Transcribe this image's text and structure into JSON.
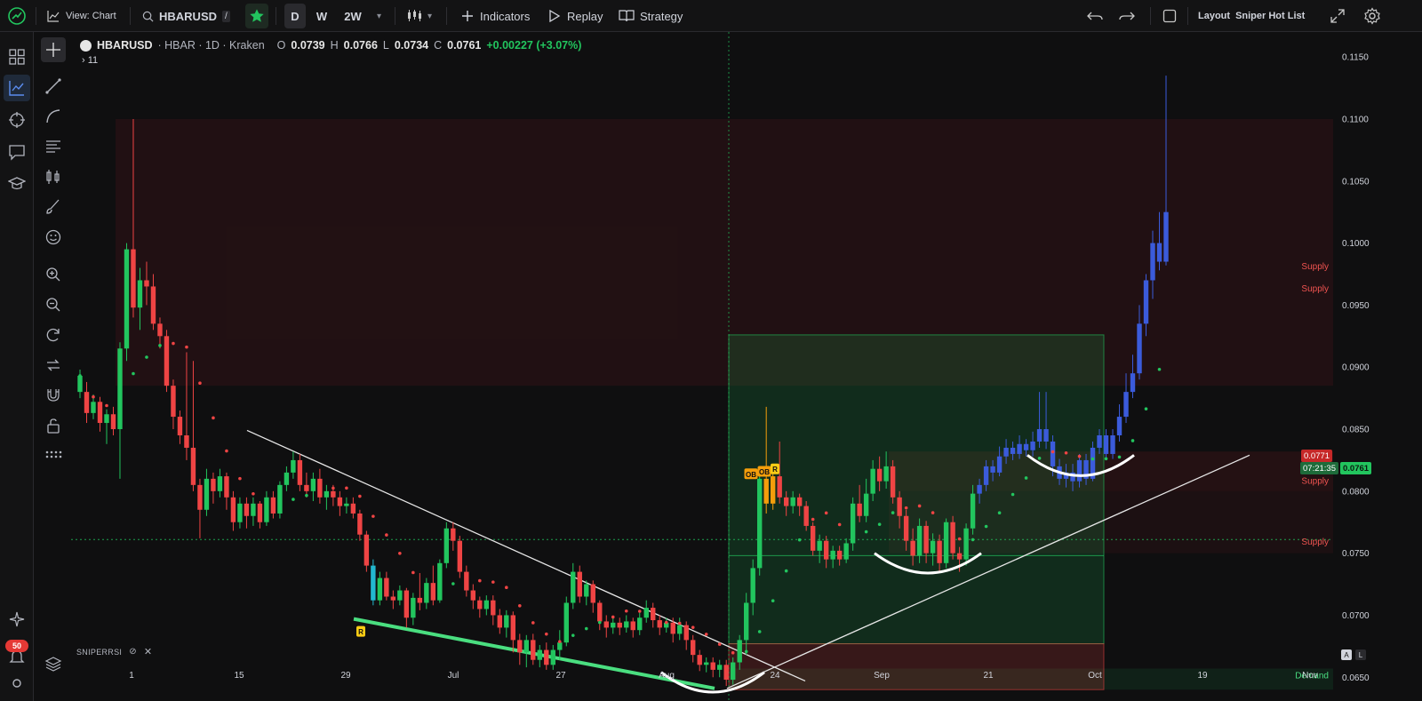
{
  "toolbar": {
    "view_label": "View: Chart",
    "symbol": "HBARUSD",
    "intervals": [
      "D",
      "W",
      "2W"
    ],
    "active_interval": "D",
    "indicators_label": "Indicators",
    "replay_label": "Replay",
    "strategy_label": "Strategy",
    "layout_prefix": "Layout",
    "layout_name": "Sniper Hot List"
  },
  "legend": {
    "symbol": "HBARUSD",
    "details": "· HBAR · 1D · Kraken",
    "open_label": "O",
    "open": "0.0739",
    "high_label": "H",
    "high": "0.0766",
    "low_label": "L",
    "low": "0.0734",
    "close_label": "C",
    "close": "0.0761",
    "change": "+0.00227 (+3.07%)",
    "collapsed": "11"
  },
  "indicator_pane": {
    "name": "SNIPERRSI"
  },
  "notifications": {
    "count": "50"
  },
  "price_tags": {
    "upper_value": "0.0771",
    "countdown": "07:21:35",
    "current": "0.0761"
  },
  "axis_buttons": {
    "auto": "A",
    "log": "L"
  },
  "colors": {
    "bull": "#22c55e",
    "bear": "#ef4444",
    "supply": "#ef4444",
    "demand": "#22c55e",
    "accent": "#2962ff",
    "blue_candle": "#3b5bdb"
  },
  "chart_data": {
    "type": "candlestick",
    "symbol": "HBARUSD",
    "timeframe": "1D",
    "x_tick_labels": [
      "1",
      "15",
      "29",
      "Jul",
      "27",
      "Aug",
      "24",
      "Sep",
      "21",
      "Oct",
      "19",
      "Nov"
    ],
    "y_tick_labels": [
      "0.1150",
      "0.1100",
      "0.1050",
      "0.1000",
      "0.0950",
      "0.0900",
      "0.0850",
      "0.0800",
      "0.0750",
      "0.0700",
      "0.0650"
    ],
    "ylim": [
      0.0633,
      0.1163
    ],
    "zones": [
      {
        "label": "Supply",
        "from": 0.0885,
        "to": 0.11
      },
      {
        "label": "Supply",
        "from": 0.0885,
        "to": 0.11
      },
      {
        "label": "Supply",
        "from": 0.08,
        "to": 0.0832
      },
      {
        "label": "Supply",
        "from": 0.075,
        "to": 0.08
      },
      {
        "label": "Demand",
        "from": 0.064,
        "to": 0.0657
      }
    ],
    "markers": [
      {
        "text": "R",
        "price": 0.069
      },
      {
        "text": "OB",
        "price": 0.0814
      },
      {
        "text": "OB",
        "price": 0.0816
      },
      {
        "text": "R",
        "price": 0.0818
      }
    ],
    "candles_segments": [
      {
        "o": 0.088,
        "c": 0.0893,
        "h": 0.0898,
        "l": 0.0875
      },
      {
        "o": 0.088,
        "c": 0.0863,
        "h": 0.0888,
        "l": 0.0855
      },
      {
        "o": 0.0863,
        "c": 0.0872,
        "h": 0.0878,
        "l": 0.0858
      },
      {
        "o": 0.0872,
        "c": 0.0855,
        "h": 0.0876,
        "l": 0.0848
      },
      {
        "o": 0.0855,
        "c": 0.0862,
        "h": 0.0866,
        "l": 0.0838
      },
      {
        "o": 0.0862,
        "c": 0.085,
        "h": 0.0868,
        "l": 0.0845
      },
      {
        "o": 0.085,
        "c": 0.0915,
        "h": 0.092,
        "l": 0.081
      },
      {
        "o": 0.0915,
        "c": 0.0995,
        "h": 0.1,
        "l": 0.0905
      },
      {
        "o": 0.0995,
        "c": 0.0948,
        "h": 0.11,
        "l": 0.094
      },
      {
        "o": 0.0948,
        "c": 0.097,
        "h": 0.098,
        "l": 0.093
      },
      {
        "o": 0.097,
        "c": 0.0965,
        "h": 0.0985,
        "l": 0.095
      },
      {
        "o": 0.0965,
        "c": 0.0935,
        "h": 0.0975,
        "l": 0.093
      },
      {
        "o": 0.0935,
        "c": 0.0925,
        "h": 0.094,
        "l": 0.0915
      },
      {
        "o": 0.0925,
        "c": 0.0885,
        "h": 0.093,
        "l": 0.088
      },
      {
        "o": 0.0885,
        "c": 0.086,
        "h": 0.089,
        "l": 0.085
      },
      {
        "o": 0.086,
        "c": 0.0845,
        "h": 0.0865,
        "l": 0.0838
      },
      {
        "o": 0.0845,
        "c": 0.0835,
        "h": 0.0912,
        "l": 0.0825
      },
      {
        "o": 0.0835,
        "c": 0.0805,
        "h": 0.0905,
        "l": 0.08
      },
      {
        "o": 0.0805,
        "c": 0.0785,
        "h": 0.081,
        "l": 0.0762
      },
      {
        "o": 0.0785,
        "c": 0.081,
        "h": 0.0818,
        "l": 0.078
      },
      {
        "o": 0.081,
        "c": 0.08,
        "h": 0.0815,
        "l": 0.079
      },
      {
        "o": 0.08,
        "c": 0.0812,
        "h": 0.0818,
        "l": 0.0795
      },
      {
        "o": 0.0812,
        "c": 0.0795,
        "h": 0.0815,
        "l": 0.0785
      },
      {
        "o": 0.0795,
        "c": 0.0775,
        "h": 0.08,
        "l": 0.0768
      },
      {
        "o": 0.0775,
        "c": 0.079,
        "h": 0.0795,
        "l": 0.077
      },
      {
        "o": 0.079,
        "c": 0.078,
        "h": 0.0795,
        "l": 0.077
      },
      {
        "o": 0.078,
        "c": 0.079,
        "h": 0.0795,
        "l": 0.0772
      },
      {
        "o": 0.079,
        "c": 0.0775,
        "h": 0.0792,
        "l": 0.077
      },
      {
        "o": 0.0775,
        "c": 0.0795,
        "h": 0.08,
        "l": 0.0772
      },
      {
        "o": 0.0795,
        "c": 0.0782,
        "h": 0.08,
        "l": 0.0778
      },
      {
        "o": 0.0782,
        "c": 0.0805,
        "h": 0.0808,
        "l": 0.0778
      },
      {
        "o": 0.0805,
        "c": 0.0815,
        "h": 0.082,
        "l": 0.08
      },
      {
        "o": 0.0815,
        "c": 0.0825,
        "h": 0.0832,
        "l": 0.081
      },
      {
        "o": 0.0825,
        "c": 0.0805,
        "h": 0.083,
        "l": 0.08
      },
      {
        "o": 0.0805,
        "c": 0.08,
        "h": 0.0815,
        "l": 0.0795
      },
      {
        "o": 0.08,
        "c": 0.081,
        "h": 0.0815,
        "l": 0.0792
      },
      {
        "o": 0.081,
        "c": 0.0795,
        "h": 0.0818,
        "l": 0.079
      },
      {
        "o": 0.0795,
        "c": 0.08,
        "h": 0.0805,
        "l": 0.0785
      },
      {
        "o": 0.08,
        "c": 0.0795,
        "h": 0.0805,
        "l": 0.0788
      },
      {
        "o": 0.0795,
        "c": 0.0788,
        "h": 0.08,
        "l": 0.078
      },
      {
        "o": 0.0788,
        "c": 0.079,
        "h": 0.0795,
        "l": 0.0782
      },
      {
        "o": 0.079,
        "c": 0.0782,
        "h": 0.0795,
        "l": 0.0778
      },
      {
        "o": 0.0782,
        "c": 0.0765,
        "h": 0.0785,
        "l": 0.076
      },
      {
        "o": 0.0765,
        "c": 0.074,
        "h": 0.0768,
        "l": 0.0735
      },
      {
        "o": 0.074,
        "c": 0.0712,
        "h": 0.0745,
        "l": 0.0708
      },
      {
        "o": 0.0712,
        "c": 0.073,
        "h": 0.0735,
        "l": 0.0708
      },
      {
        "o": 0.073,
        "c": 0.0715,
        "h": 0.0735,
        "l": 0.0712
      },
      {
        "o": 0.0715,
        "c": 0.0712,
        "h": 0.072,
        "l": 0.0705
      },
      {
        "o": 0.0712,
        "c": 0.072,
        "h": 0.0724,
        "l": 0.0708
      },
      {
        "o": 0.072,
        "c": 0.0698,
        "h": 0.0722,
        "l": 0.069
      },
      {
        "o": 0.0698,
        "c": 0.0714,
        "h": 0.0718,
        "l": 0.0692
      },
      {
        "o": 0.0714,
        "c": 0.071,
        "h": 0.0734,
        "l": 0.0704
      },
      {
        "o": 0.071,
        "c": 0.0726,
        "h": 0.073,
        "l": 0.0705
      },
      {
        "o": 0.0726,
        "c": 0.0712,
        "h": 0.074,
        "l": 0.0708
      },
      {
        "o": 0.0712,
        "c": 0.0742,
        "h": 0.0745,
        "l": 0.071
      },
      {
        "o": 0.0742,
        "c": 0.077,
        "h": 0.0775,
        "l": 0.0738
      },
      {
        "o": 0.077,
        "c": 0.076,
        "h": 0.0775,
        "l": 0.0752
      },
      {
        "o": 0.076,
        "c": 0.0735,
        "h": 0.0764,
        "l": 0.073
      },
      {
        "o": 0.0735,
        "c": 0.072,
        "h": 0.074,
        "l": 0.0715
      },
      {
        "o": 0.072,
        "c": 0.0712,
        "h": 0.0725,
        "l": 0.0705
      },
      {
        "o": 0.0712,
        "c": 0.0705,
        "h": 0.0715,
        "l": 0.0698
      },
      {
        "o": 0.0705,
        "c": 0.0712,
        "h": 0.0716,
        "l": 0.07
      },
      {
        "o": 0.0712,
        "c": 0.07,
        "h": 0.0716,
        "l": 0.0692
      },
      {
        "o": 0.07,
        "c": 0.069,
        "h": 0.0705,
        "l": 0.0685
      },
      {
        "o": 0.069,
        "c": 0.07,
        "h": 0.0704,
        "l": 0.0682
      },
      {
        "o": 0.07,
        "c": 0.068,
        "h": 0.0703,
        "l": 0.067
      },
      {
        "o": 0.068,
        "c": 0.067,
        "h": 0.0685,
        "l": 0.066
      },
      {
        "o": 0.067,
        "c": 0.068,
        "h": 0.0684,
        "l": 0.0658
      },
      {
        "o": 0.068,
        "c": 0.0664,
        "h": 0.0685,
        "l": 0.066
      },
      {
        "o": 0.0664,
        "c": 0.0672,
        "h": 0.0676,
        "l": 0.0658
      },
      {
        "o": 0.0672,
        "c": 0.066,
        "h": 0.0678,
        "l": 0.0656
      },
      {
        "o": 0.066,
        "c": 0.0672,
        "h": 0.0676,
        "l": 0.0656
      },
      {
        "o": 0.0672,
        "c": 0.0678,
        "h": 0.0688,
        "l": 0.0664
      },
      {
        "o": 0.0678,
        "c": 0.071,
        "h": 0.0715,
        "l": 0.0675
      },
      {
        "o": 0.071,
        "c": 0.0735,
        "h": 0.0742,
        "l": 0.0705
      },
      {
        "o": 0.0735,
        "c": 0.0715,
        "h": 0.074,
        "l": 0.071
      },
      {
        "o": 0.0715,
        "c": 0.0725,
        "h": 0.0728,
        "l": 0.0708
      },
      {
        "o": 0.0725,
        "c": 0.071,
        "h": 0.0728,
        "l": 0.0702
      },
      {
        "o": 0.071,
        "c": 0.0695,
        "h": 0.0712,
        "l": 0.0688
      },
      {
        "o": 0.0695,
        "c": 0.069,
        "h": 0.07,
        "l": 0.0682
      },
      {
        "o": 0.069,
        "c": 0.0694,
        "h": 0.0698,
        "l": 0.0685
      },
      {
        "o": 0.0694,
        "c": 0.069,
        "h": 0.0698,
        "l": 0.0684
      },
      {
        "o": 0.069,
        "c": 0.0695,
        "h": 0.07,
        "l": 0.0686
      },
      {
        "o": 0.0695,
        "c": 0.0688,
        "h": 0.0698,
        "l": 0.0682
      },
      {
        "o": 0.0688,
        "c": 0.0698,
        "h": 0.0702,
        "l": 0.0684
      },
      {
        "o": 0.0698,
        "c": 0.0706,
        "h": 0.0712,
        "l": 0.0694
      },
      {
        "o": 0.0706,
        "c": 0.0696,
        "h": 0.071,
        "l": 0.069
      },
      {
        "o": 0.0696,
        "c": 0.069,
        "h": 0.07,
        "l": 0.0684
      },
      {
        "o": 0.069,
        "c": 0.0694,
        "h": 0.0698,
        "l": 0.0686
      },
      {
        "o": 0.0694,
        "c": 0.0685,
        "h": 0.0698,
        "l": 0.0678
      },
      {
        "o": 0.0685,
        "c": 0.0692,
        "h": 0.0698,
        "l": 0.068
      },
      {
        "o": 0.0692,
        "c": 0.068,
        "h": 0.0695,
        "l": 0.0672
      },
      {
        "o": 0.068,
        "c": 0.0668,
        "h": 0.0684,
        "l": 0.0662
      },
      {
        "o": 0.0668,
        "c": 0.066,
        "h": 0.0672,
        "l": 0.0655
      },
      {
        "o": 0.066,
        "c": 0.0662,
        "h": 0.0666,
        "l": 0.0654
      },
      {
        "o": 0.0662,
        "c": 0.0656,
        "h": 0.0666,
        "l": 0.065
      },
      {
        "o": 0.0656,
        "c": 0.066,
        "h": 0.0664,
        "l": 0.065
      },
      {
        "o": 0.066,
        "c": 0.0648,
        "h": 0.0664,
        "l": 0.0643
      },
      {
        "o": 0.0648,
        "c": 0.0662,
        "h": 0.0666,
        "l": 0.0644
      },
      {
        "o": 0.0662,
        "c": 0.068,
        "h": 0.0684,
        "l": 0.0656
      },
      {
        "o": 0.068,
        "c": 0.071,
        "h": 0.0718,
        "l": 0.0668
      },
      {
        "o": 0.071,
        "c": 0.0738,
        "h": 0.0745,
        "l": 0.07
      },
      {
        "o": 0.0738,
        "c": 0.081,
        "h": 0.0815,
        "l": 0.0732
      },
      {
        "o": 0.081,
        "c": 0.079,
        "h": 0.0868,
        "l": 0.0782
      },
      {
        "o": 0.079,
        "c": 0.0812,
        "h": 0.0818,
        "l": 0.0785
      },
      {
        "o": 0.0812,
        "c": 0.0795,
        "h": 0.084,
        "l": 0.079
      },
      {
        "o": 0.0795,
        "c": 0.0788,
        "h": 0.08,
        "l": 0.078
      },
      {
        "o": 0.0788,
        "c": 0.0795,
        "h": 0.08,
        "l": 0.0782
      },
      {
        "o": 0.0795,
        "c": 0.0788,
        "h": 0.0798,
        "l": 0.078
      },
      {
        "o": 0.0788,
        "c": 0.0772,
        "h": 0.0792,
        "l": 0.0768
      },
      {
        "o": 0.0772,
        "c": 0.0752,
        "h": 0.0775,
        "l": 0.0748
      },
      {
        "o": 0.0752,
        "c": 0.076,
        "h": 0.0765,
        "l": 0.0742
      },
      {
        "o": 0.076,
        "c": 0.0745,
        "h": 0.0764,
        "l": 0.0738
      },
      {
        "o": 0.0745,
        "c": 0.0752,
        "h": 0.0756,
        "l": 0.0738
      },
      {
        "o": 0.0752,
        "c": 0.0745,
        "h": 0.0756,
        "l": 0.074
      },
      {
        "o": 0.0745,
        "c": 0.0758,
        "h": 0.0762,
        "l": 0.0742
      },
      {
        "o": 0.0758,
        "c": 0.079,
        "h": 0.0795,
        "l": 0.0752
      },
      {
        "o": 0.079,
        "c": 0.078,
        "h": 0.0805,
        "l": 0.0775
      },
      {
        "o": 0.078,
        "c": 0.0798,
        "h": 0.081,
        "l": 0.0775
      },
      {
        "o": 0.0798,
        "c": 0.0818,
        "h": 0.0825,
        "l": 0.0792
      },
      {
        "o": 0.0818,
        "c": 0.0808,
        "h": 0.0828,
        "l": 0.08
      },
      {
        "o": 0.0808,
        "c": 0.082,
        "h": 0.0832,
        "l": 0.0802
      },
      {
        "o": 0.082,
        "c": 0.0795,
        "h": 0.0825,
        "l": 0.079
      },
      {
        "o": 0.0795,
        "c": 0.078,
        "h": 0.08,
        "l": 0.077
      },
      {
        "o": 0.078,
        "c": 0.076,
        "h": 0.0785,
        "l": 0.0752
      },
      {
        "o": 0.076,
        "c": 0.0748,
        "h": 0.077,
        "l": 0.074
      },
      {
        "o": 0.0748,
        "c": 0.0772,
        "h": 0.0778,
        "l": 0.0742
      },
      {
        "o": 0.0772,
        "c": 0.075,
        "h": 0.0776,
        "l": 0.0742
      },
      {
        "o": 0.075,
        "c": 0.076,
        "h": 0.0766,
        "l": 0.074
      },
      {
        "o": 0.076,
        "c": 0.0742,
        "h": 0.0765,
        "l": 0.0735
      },
      {
        "o": 0.0742,
        "c": 0.0775,
        "h": 0.0778,
        "l": 0.0738
      },
      {
        "o": 0.0775,
        "c": 0.075,
        "h": 0.078,
        "l": 0.0745
      },
      {
        "o": 0.075,
        "c": 0.0745,
        "h": 0.0755,
        "l": 0.0735
      },
      {
        "o": 0.0745,
        "c": 0.077,
        "h": 0.0774,
        "l": 0.074
      },
      {
        "o": 0.077,
        "c": 0.0798,
        "h": 0.0805,
        "l": 0.0765
      },
      {
        "o": 0.0798,
        "c": 0.0805,
        "h": 0.081,
        "l": 0.079
      },
      {
        "o": 0.0805,
        "c": 0.082,
        "h": 0.0825,
        "l": 0.08
      },
      {
        "o": 0.082,
        "c": 0.0815,
        "h": 0.0825,
        "l": 0.0808
      },
      {
        "o": 0.0815,
        "c": 0.0828,
        "h": 0.0836,
        "l": 0.0812
      },
      {
        "o": 0.0828,
        "c": 0.0835,
        "h": 0.0842,
        "l": 0.0822
      },
      {
        "o": 0.0835,
        "c": 0.083,
        "h": 0.084,
        "l": 0.0825
      },
      {
        "o": 0.083,
        "c": 0.0838,
        "h": 0.0845,
        "l": 0.0826
      },
      {
        "o": 0.0838,
        "c": 0.0833,
        "h": 0.0842,
        "l": 0.0828
      },
      {
        "o": 0.0833,
        "c": 0.084,
        "h": 0.0848,
        "l": 0.0828
      },
      {
        "o": 0.084,
        "c": 0.085,
        "h": 0.088,
        "l": 0.0835
      },
      {
        "o": 0.085,
        "c": 0.084,
        "h": 0.088,
        "l": 0.0834
      },
      {
        "o": 0.084,
        "c": 0.082,
        "h": 0.0845,
        "l": 0.0812
      },
      {
        "o": 0.082,
        "c": 0.081,
        "h": 0.0826,
        "l": 0.0805
      },
      {
        "o": 0.081,
        "c": 0.0815,
        "h": 0.0822,
        "l": 0.0803
      },
      {
        "o": 0.0815,
        "c": 0.0808,
        "h": 0.0822,
        "l": 0.08
      },
      {
        "o": 0.0808,
        "c": 0.0825,
        "h": 0.083,
        "l": 0.0803
      },
      {
        "o": 0.0825,
        "c": 0.081,
        "h": 0.083,
        "l": 0.0805
      },
      {
        "o": 0.081,
        "c": 0.0835,
        "h": 0.084,
        "l": 0.0808
      },
      {
        "o": 0.0835,
        "c": 0.0845,
        "h": 0.085,
        "l": 0.083
      },
      {
        "o": 0.0845,
        "c": 0.083,
        "h": 0.085,
        "l": 0.0825
      },
      {
        "o": 0.083,
        "c": 0.0845,
        "h": 0.085,
        "l": 0.0826
      },
      {
        "o": 0.0845,
        "c": 0.086,
        "h": 0.087,
        "l": 0.084
      },
      {
        "o": 0.086,
        "c": 0.088,
        "h": 0.0895,
        "l": 0.0855
      },
      {
        "o": 0.088,
        "c": 0.0895,
        "h": 0.091,
        "l": 0.0875
      },
      {
        "o": 0.0895,
        "c": 0.0935,
        "h": 0.095,
        "l": 0.089
      },
      {
        "o": 0.0935,
        "c": 0.097,
        "h": 0.0975,
        "l": 0.0925
      },
      {
        "o": 0.097,
        "c": 0.1,
        "h": 0.101,
        "l": 0.0955
      },
      {
        "o": 0.1,
        "c": 0.0985,
        "h": 0.1025,
        "l": 0.0978
      },
      {
        "o": 0.0985,
        "c": 0.1025,
        "h": 0.1135,
        "l": 0.0982
      }
    ]
  }
}
